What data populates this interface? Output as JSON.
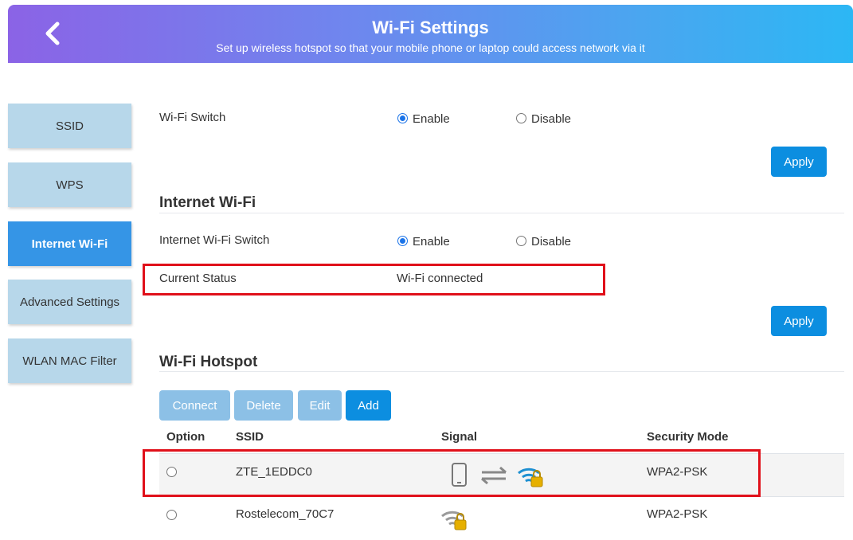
{
  "header": {
    "title": "Wi-Fi Settings",
    "subtitle": "Set up wireless hotspot so that your mobile phone or laptop could access network via it"
  },
  "sidebar": {
    "items": [
      {
        "label": "SSID"
      },
      {
        "label": "WPS"
      },
      {
        "label": "Internet Wi-Fi",
        "active": true
      },
      {
        "label": "Advanced Settings"
      },
      {
        "label": "WLAN MAC Filter"
      }
    ]
  },
  "wifi_switch": {
    "label": "Wi-Fi Switch",
    "enable_label": "Enable",
    "disable_label": "Disable",
    "selected": "Enable",
    "apply_label": "Apply"
  },
  "internet_wifi": {
    "title": "Internet Wi-Fi",
    "switch_label": "Internet Wi-Fi Switch",
    "enable_label": "Enable",
    "disable_label": "Disable",
    "selected": "Enable",
    "status_label": "Current Status",
    "status_value": "Wi-Fi connected",
    "apply_label": "Apply"
  },
  "hotspot": {
    "title": "Wi-Fi Hotspot",
    "buttons": {
      "connect": "Connect",
      "delete": "Delete",
      "edit": "Edit",
      "add": "Add"
    },
    "columns": [
      "Option",
      "SSID",
      "Signal",
      "Security Mode"
    ],
    "rows": [
      {
        "ssid": "ZTE_1EDDC0",
        "security": "WPA2-PSK",
        "connected": true
      },
      {
        "ssid": "Rostelecom_70C7",
        "security": "WPA2-PSK",
        "connected": false
      }
    ]
  },
  "colors": {
    "primary": "#0c8ee0",
    "active_tab": "#3595e6",
    "tab": "#b7d7ea",
    "highlight": "#e0101a"
  }
}
